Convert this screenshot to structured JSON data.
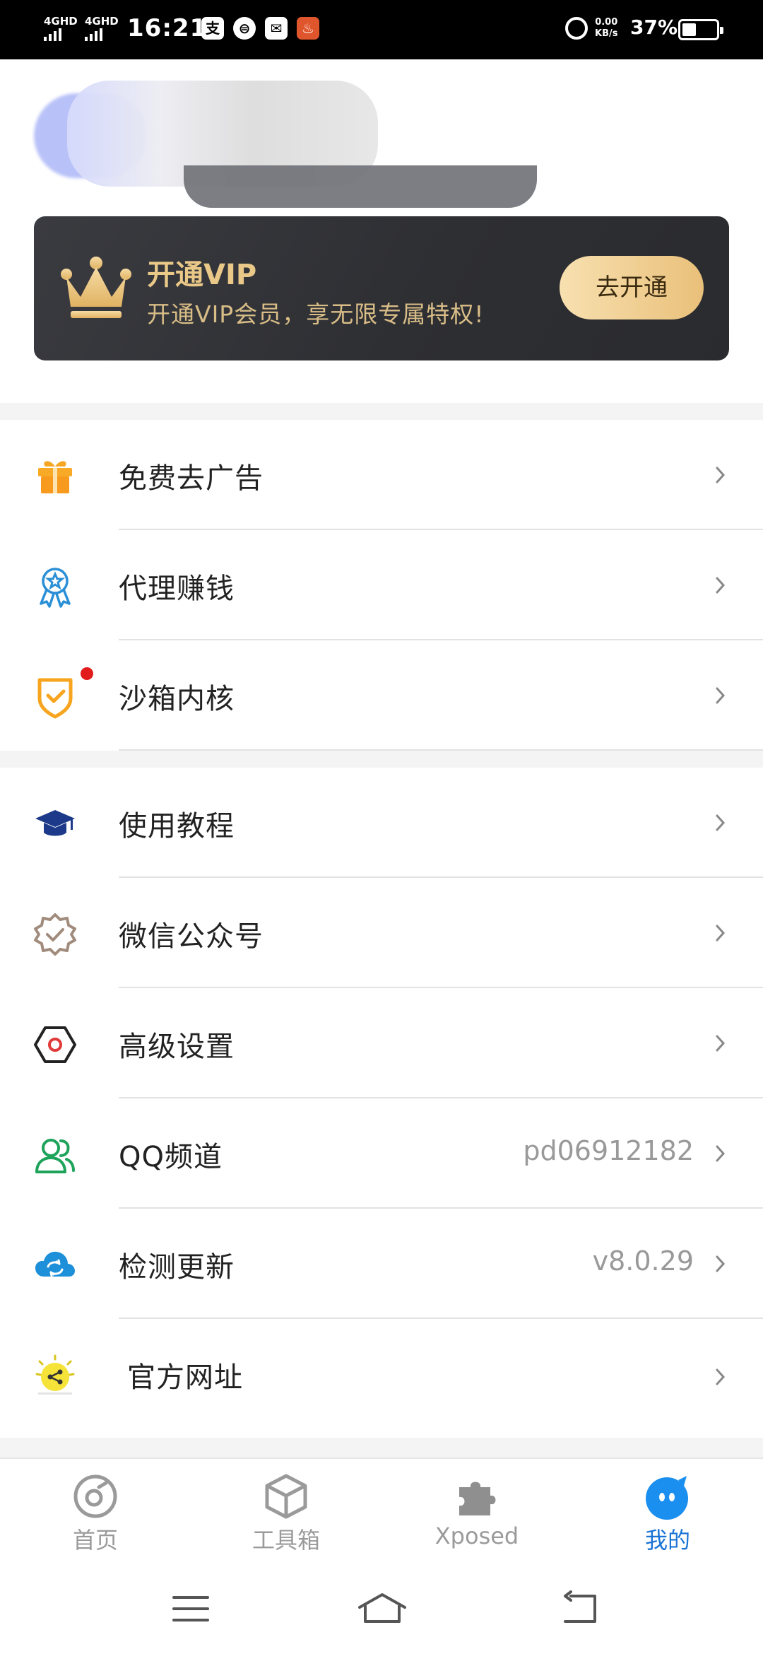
{
  "status_bar": {
    "network1": "4GHD",
    "network2": "4GHD",
    "time": "16:21",
    "app_icon_alipay": "支",
    "app_icon_2": "⊜",
    "speed": "0.00",
    "speed_unit": "KB/s",
    "battery": "37%",
    "battery_level": 0.37
  },
  "vip": {
    "title": "开通VIP",
    "subtitle": "开通VIP会员，享无限专属特权!",
    "button": "去开通",
    "text_color": "#e9c888"
  },
  "menu_group1": [
    {
      "label": "免费去广告",
      "icon": "gift-icon"
    },
    {
      "label": "代理赚钱",
      "icon": "medal-icon"
    },
    {
      "label": "沙箱内核",
      "icon": "shield-icon"
    }
  ],
  "menu_group2": [
    {
      "label": "使用教程",
      "icon": "graduation-cap-icon",
      "value": ""
    },
    {
      "label": "微信公众号",
      "icon": "verified-badge-icon",
      "value": ""
    },
    {
      "label": "高级设置",
      "icon": "hexagon-settings-icon",
      "value": ""
    },
    {
      "label": "QQ频道",
      "icon": "users-icon",
      "value": "pd06912182"
    },
    {
      "label": "检测更新",
      "icon": "cloud-sync-icon",
      "value": "v8.0.29"
    },
    {
      "label": "官方网址",
      "icon": "share-icon",
      "value": ""
    }
  ],
  "bottom_nav": {
    "items": [
      {
        "label": "首页",
        "icon": "home-disc-icon"
      },
      {
        "label": "工具箱",
        "icon": "box-icon"
      },
      {
        "label": "Xposed",
        "icon": "puzzle-icon"
      },
      {
        "label": "我的",
        "icon": "profile-face-icon"
      }
    ],
    "active_index": 3,
    "active_color": "#1a74d6"
  },
  "system_nav": [
    "menu-icon",
    "home-icon",
    "back-icon"
  ]
}
